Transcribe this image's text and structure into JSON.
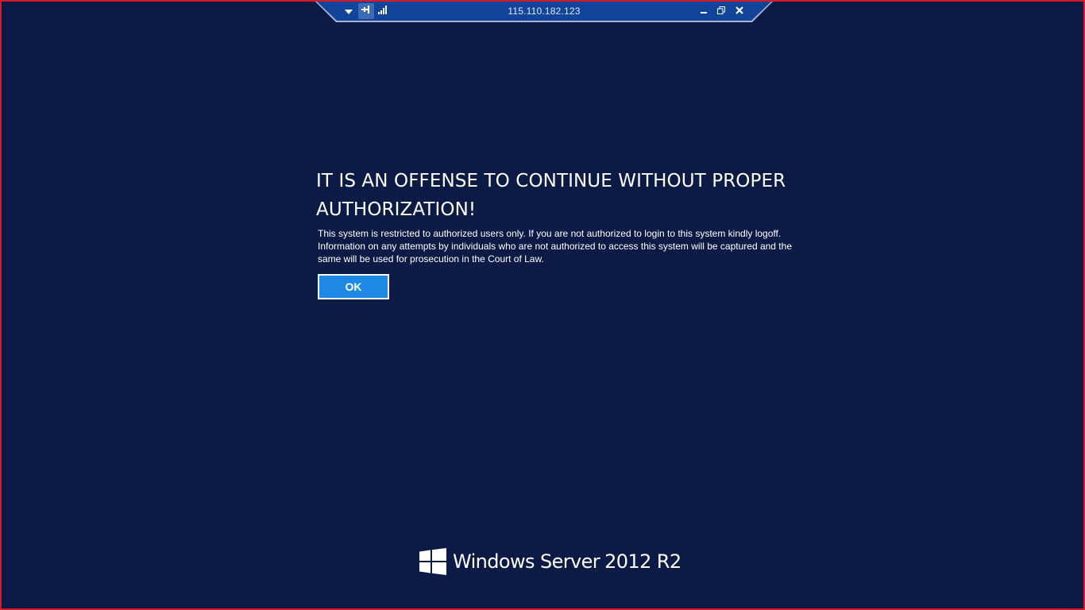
{
  "rdp_bar": {
    "address": "115.110.182.123",
    "icons": [
      "dropdown-arrow-icon",
      "pin-icon",
      "connection-signal-icon",
      "minimize-icon",
      "restore-icon",
      "close-icon"
    ]
  },
  "notice": {
    "title": "IT IS AN OFFENSE TO CONTINUE WITHOUT PROPER AUTHORIZATION!",
    "body": "This system is restricted to authorized users only. If you are not authorized to login to this system kindly logoff. Information on any attempts by individuals who are not authorized to access this system will be captured and the same will be used for prosecution in the Court of Law.",
    "ok_label": "OK"
  },
  "branding": {
    "product": "Windows Server",
    "version": "2012 R2"
  },
  "colors": {
    "background": "#0b1b46",
    "button": "#1e88e5",
    "frame_border": "#d21c2b",
    "rdp_bar": "#12449a"
  }
}
